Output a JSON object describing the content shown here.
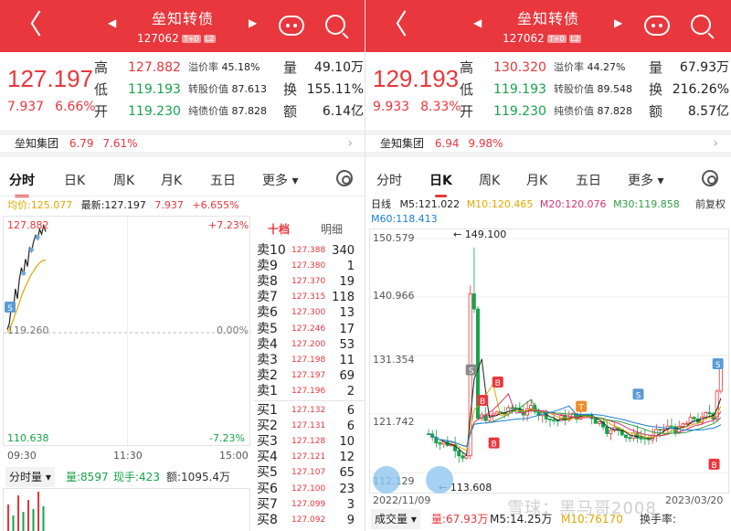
{
  "left": {
    "header": {
      "title": "垒知转债",
      "code": "127062",
      "badge1": "T+0",
      "badge2": "L2",
      "prev": "◀",
      "next": "▶",
      "back": "〈"
    },
    "quote": {
      "price": "127.197",
      "change": "7.937",
      "pct": "6.66%",
      "high": "127.882",
      "low": "119.193",
      "open": "119.230",
      "premium_label": "溢价率",
      "premium": "45.18%",
      "conv_label": "转股价值",
      "conv": "87.613",
      "bond_label": "纯债价值",
      "bond": "87.828",
      "vol_label": "量",
      "vol": "49.10万",
      "turn_label": "换",
      "turn": "155.11%",
      "amt_label": "额",
      "amt": "6.14亿",
      "high_label": "高",
      "low_label": "低",
      "open_label": "开"
    },
    "related": {
      "name": "垒知集团",
      "price": "6.79",
      "pct": "7.61%"
    },
    "tabs": [
      "分时",
      "日K",
      "周K",
      "月K",
      "五日",
      "更多 ▾"
    ],
    "active_tab": 0,
    "info": {
      "avg_label": "均价:125.077",
      "latest_label": "最新:127.197",
      "change": "7.937",
      "pct": "+6.655%"
    },
    "intraday": {
      "y_top": "127.882",
      "y_mid": "119.260",
      "y_bottom": "110.638",
      "pct_top": "+7.23%",
      "pct_mid": "0.00%",
      "pct_bottom": "-7.23%",
      "time_start": "09:30",
      "time_mid": "11:30",
      "time_end": "15:00",
      "price_series": [
        119.5,
        120.0,
        121.4,
        121.0,
        122.8,
        122.0,
        123.6,
        124.5,
        123.9,
        125.2,
        124.6,
        126.1,
        125.8,
        126.6,
        127.1,
        126.8,
        127.6,
        127.2,
        127.9,
        127.4
      ],
      "avg_series": [
        119.3,
        119.5,
        119.9,
        120.3,
        120.8,
        121.2,
        121.7,
        122.2,
        122.6,
        123.0,
        123.3,
        123.7,
        124.0,
        124.2,
        124.5,
        124.7,
        124.9,
        125.0,
        125.1,
        125.1
      ],
      "marker": "S"
    },
    "orderbook": {
      "tab1": "十档",
      "tab2": "明细",
      "asks": [
        {
          "label": "卖10",
          "price": "127.388",
          "vol": "340"
        },
        {
          "label": "卖9",
          "price": "127.380",
          "vol": "1"
        },
        {
          "label": "卖8",
          "price": "127.370",
          "vol": "19"
        },
        {
          "label": "卖7",
          "price": "127.315",
          "vol": "118"
        },
        {
          "label": "卖6",
          "price": "127.300",
          "vol": "13"
        },
        {
          "label": "卖5",
          "price": "127.246",
          "vol": "17"
        },
        {
          "label": "卖4",
          "price": "127.200",
          "vol": "53"
        },
        {
          "label": "卖3",
          "price": "127.198",
          "vol": "11"
        },
        {
          "label": "卖2",
          "price": "127.197",
          "vol": "69"
        },
        {
          "label": "卖1",
          "price": "127.196",
          "vol": "2"
        }
      ],
      "bids": [
        {
          "label": "买1",
          "price": "127.132",
          "vol": "6"
        },
        {
          "label": "买2",
          "price": "127.131",
          "vol": "6"
        },
        {
          "label": "买3",
          "price": "127.128",
          "vol": "10"
        },
        {
          "label": "买4",
          "price": "127.121",
          "vol": "12"
        },
        {
          "label": "买5",
          "price": "127.107",
          "vol": "65"
        },
        {
          "label": "买6",
          "price": "127.100",
          "vol": "23"
        },
        {
          "label": "买7",
          "price": "127.099",
          "vol": "3"
        },
        {
          "label": "买8",
          "price": "127.092",
          "vol": "9"
        }
      ]
    },
    "bottom": {
      "selector": "分时量 ▾",
      "vol": "量:8597",
      "now": "现手:423",
      "amt": "额:1095.4万"
    }
  },
  "right": {
    "header": {
      "title": "垒知转债",
      "code": "127062",
      "badge1": "T+0",
      "badge2": "L2",
      "prev": "◀",
      "next": "▶",
      "back": "〈"
    },
    "quote": {
      "price": "129.193",
      "change": "9.933",
      "pct": "8.33%",
      "high": "130.320",
      "low": "119.193",
      "open": "119.230",
      "premium_label": "溢价率",
      "premium": "44.27%",
      "conv_label": "转股价值",
      "conv": "89.548",
      "bond_label": "纯债价值",
      "bond": "87.828",
      "vol_label": "量",
      "vol": "67.93万",
      "turn_label": "换",
      "turn": "216.26%",
      "amt_label": "额",
      "amt": "8.57亿",
      "high_label": "高",
      "low_label": "低",
      "open_label": "开"
    },
    "related": {
      "name": "垒知集团",
      "price": "6.94",
      "pct": "9.98%"
    },
    "tabs": [
      "分时",
      "日K",
      "周K",
      "月K",
      "五日",
      "更多 ▾"
    ],
    "active_tab": 1,
    "ma": {
      "label": "日线",
      "m5": "M5:121.022",
      "m10": "M10:120.465",
      "m20": "M20:120.076",
      "m30": "M30:119.858",
      "m60": "M60:118.413",
      "adjust": "前复权"
    },
    "kline": {
      "y_labels": [
        "150.579",
        "140.966",
        "131.354",
        "121.742",
        "112.129"
      ],
      "high_marker": "149.100",
      "low_marker": "113.608",
      "date_start": "2022/11/09",
      "date_end": "2023/03/20"
    },
    "bottom": {
      "selector": "成交量 ▾",
      "vol": "量:67.93万",
      "m5": "M5:14.25万",
      "m10": "M10:76170",
      "turn": "换手率:"
    },
    "watermark": "雪球：黑马哥2008"
  },
  "colors": {
    "brand": "#e8373d",
    "up": "#e8373d",
    "down": "#16a34a",
    "m5": "#222222",
    "m10": "#e0a800",
    "m20": "#d6336c",
    "m30": "#2f9e44",
    "m60": "#1c7ed6"
  }
}
